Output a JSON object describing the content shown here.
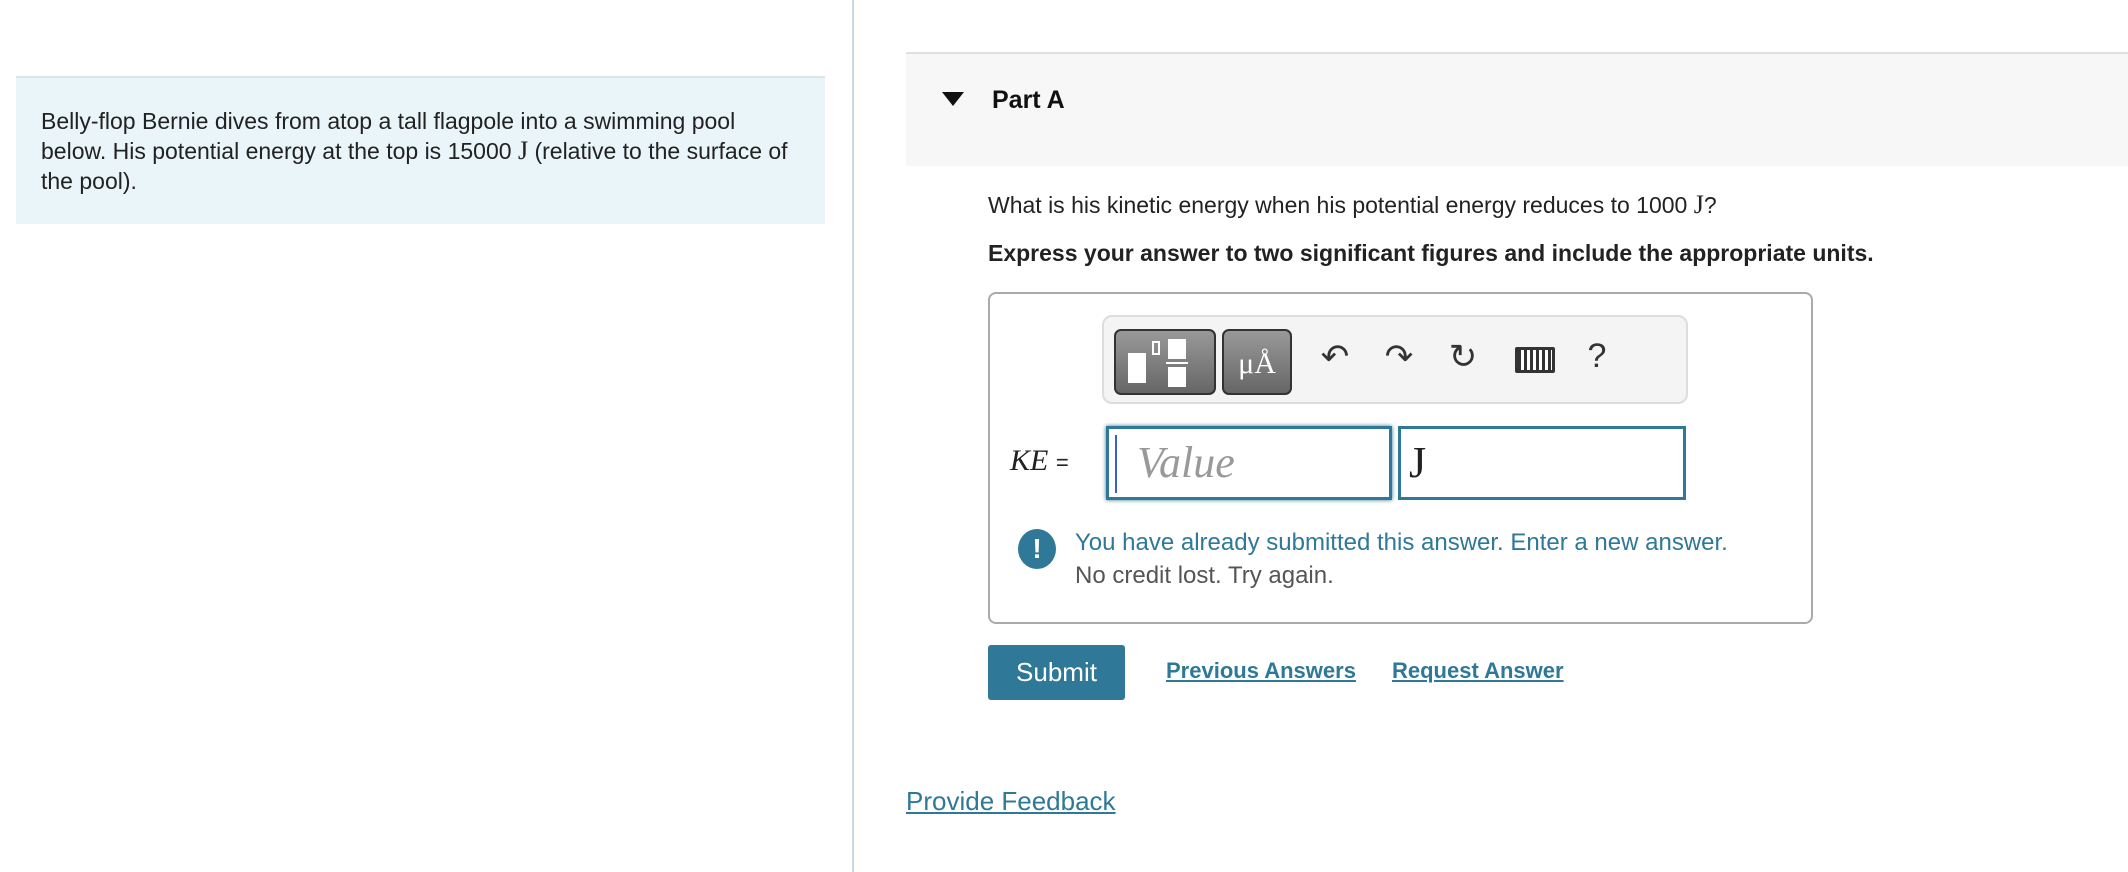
{
  "intro": {
    "text_before": "Belly-flop Bernie dives from atop a tall flagpole into a swimming pool below. His potential energy at the top is 15000 ",
    "unit": "J",
    "text_after": " (relative to the surface of the pool)."
  },
  "part": {
    "title": "Part A",
    "question_before": "What is his kinetic energy when his potential energy reduces to 1000 ",
    "question_unit": "J",
    "question_after": "?",
    "instruction": "Express your answer to two significant figures and include the appropriate units."
  },
  "toolbar": {
    "templates_icon": "fraction-template-icon",
    "units_label": "μÅ",
    "undo_icon": "undo-icon",
    "redo_icon": "redo-icon",
    "reset_icon": "reset-icon",
    "keyboard_icon": "keyboard-icon",
    "help_label": "?"
  },
  "answer": {
    "label": "KE",
    "equals": "=",
    "value_placeholder": "Value",
    "unit_value": "J"
  },
  "feedback": {
    "line1": "You have already submitted this answer. Enter a new answer.",
    "line2": "No credit lost. Try again."
  },
  "actions": {
    "submit": "Submit",
    "previous_answers": "Previous Answers",
    "request_answer": "Request Answer"
  },
  "provide_feedback": "Provide Feedback",
  "colors": {
    "accent": "#2f7897",
    "intro_bg": "#e9f5f8",
    "header_bg": "#f7f7f7"
  }
}
